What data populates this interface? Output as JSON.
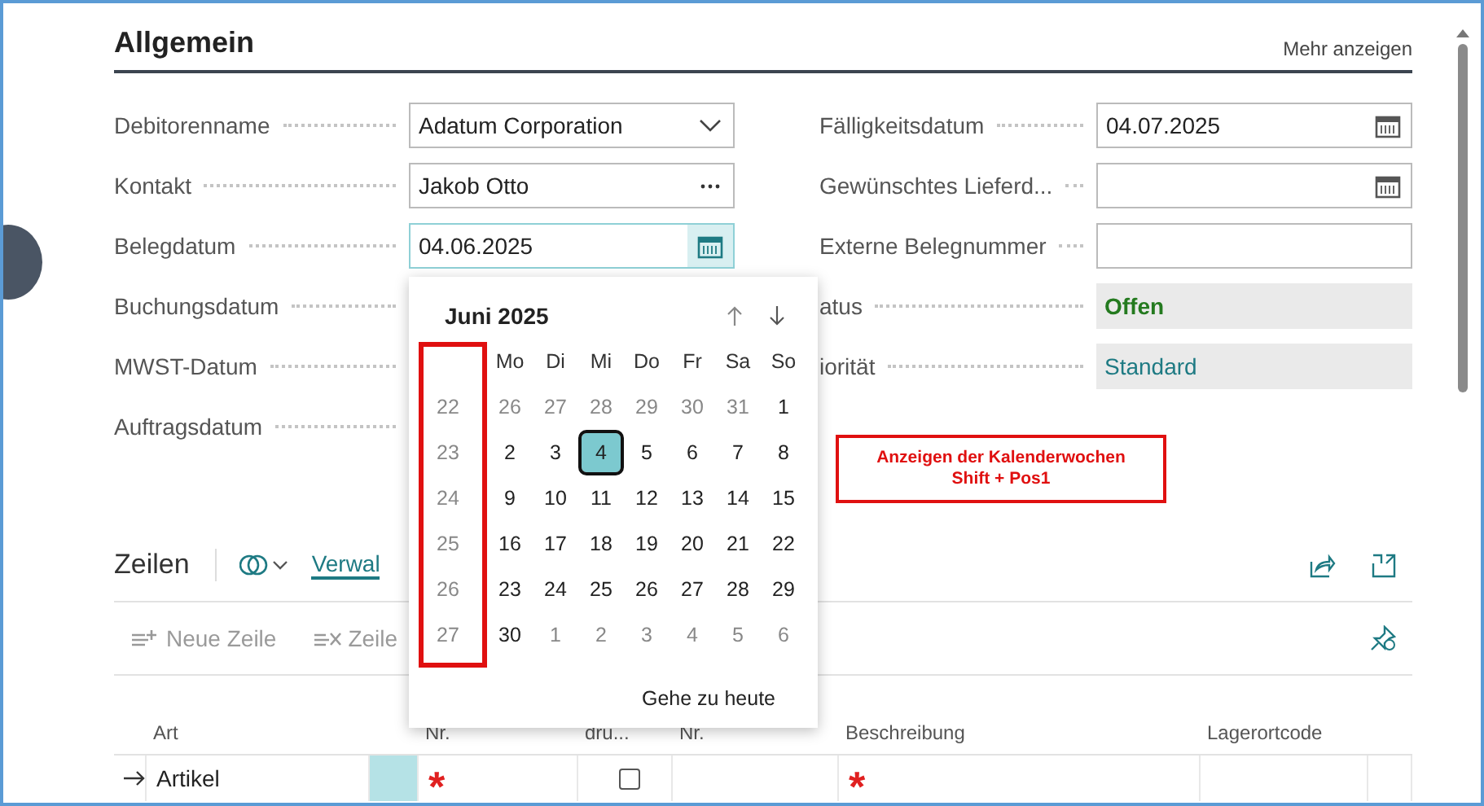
{
  "section": {
    "title": "Allgemein",
    "more_link": "Mehr anzeigen"
  },
  "fields_left": [
    {
      "label": "Debitorenname",
      "kind": "dropdown",
      "value": "Adatum Corporation"
    },
    {
      "label": "Kontakt",
      "kind": "lookup",
      "value": "Jakob Otto"
    },
    {
      "label": "Belegdatum",
      "kind": "date",
      "value": "04.06.2025",
      "focused": true
    },
    {
      "label": "Buchungsdatum",
      "kind": "covered"
    },
    {
      "label": "MWST-Datum",
      "kind": "covered"
    },
    {
      "label": "Auftragsdatum",
      "kind": "covered"
    }
  ],
  "fields_right": [
    {
      "label": "Fälligkeitsdatum",
      "kind": "date",
      "value": "04.07.2025",
      "focused": false
    },
    {
      "label": "Gewünschtes Lieferd...",
      "kind": "date",
      "focused": false
    },
    {
      "label": "Externe Belegnummer",
      "kind": "text"
    },
    {
      "label": "atus",
      "kind": "status",
      "value": "Offen"
    },
    {
      "label": "iorität",
      "kind": "readonly",
      "value": "Standard"
    }
  ],
  "calendar": {
    "month": "Juni 2025",
    "weekdays": [
      "Mo",
      "Di",
      "Mi",
      "Do",
      "Fr",
      "Sa",
      "So"
    ],
    "weeks": [
      {
        "number": "22",
        "days": [
          {
            "label": "26",
            "muted": true,
            "selected": false
          },
          {
            "label": "27",
            "muted": true,
            "selected": false
          },
          {
            "label": "28",
            "muted": true,
            "selected": false
          },
          {
            "label": "29",
            "muted": true,
            "selected": false
          },
          {
            "label": "30",
            "muted": true,
            "selected": false
          },
          {
            "label": "31",
            "muted": true,
            "selected": false
          },
          {
            "label": "1",
            "muted": false,
            "selected": false
          }
        ]
      },
      {
        "number": "23",
        "days": [
          {
            "label": "2",
            "muted": false,
            "selected": false
          },
          {
            "label": "3",
            "muted": false,
            "selected": false
          },
          {
            "label": "4",
            "muted": false,
            "selected": true
          },
          {
            "label": "5",
            "muted": false,
            "selected": false
          },
          {
            "label": "6",
            "muted": false,
            "selected": false
          },
          {
            "label": "7",
            "muted": false,
            "selected": false
          },
          {
            "label": "8",
            "muted": false,
            "selected": false
          }
        ]
      },
      {
        "number": "24",
        "days": [
          {
            "label": "9",
            "muted": false,
            "selected": false
          },
          {
            "label": "10",
            "muted": false,
            "selected": false
          },
          {
            "label": "11",
            "muted": false,
            "selected": false
          },
          {
            "label": "12",
            "muted": false,
            "selected": false
          },
          {
            "label": "13",
            "muted": false,
            "selected": false
          },
          {
            "label": "14",
            "muted": false,
            "selected": false
          },
          {
            "label": "15",
            "muted": false,
            "selected": false
          }
        ]
      },
      {
        "number": "25",
        "days": [
          {
            "label": "16",
            "muted": false,
            "selected": false
          },
          {
            "label": "17",
            "muted": false,
            "selected": false
          },
          {
            "label": "18",
            "muted": false,
            "selected": false
          },
          {
            "label": "19",
            "muted": false,
            "selected": false
          },
          {
            "label": "20",
            "muted": false,
            "selected": false
          },
          {
            "label": "21",
            "muted": false,
            "selected": false
          },
          {
            "label": "22",
            "muted": false,
            "selected": false
          }
        ]
      },
      {
        "number": "26",
        "days": [
          {
            "label": "23",
            "muted": false,
            "selected": false
          },
          {
            "label": "24",
            "muted": false,
            "selected": false
          },
          {
            "label": "25",
            "muted": false,
            "selected": false
          },
          {
            "label": "26",
            "muted": false,
            "selected": false
          },
          {
            "label": "27",
            "muted": false,
            "selected": false
          },
          {
            "label": "28",
            "muted": false,
            "selected": false
          },
          {
            "label": "29",
            "muted": false,
            "selected": false
          }
        ]
      },
      {
        "number": "27",
        "days": [
          {
            "label": "30",
            "muted": false,
            "selected": false
          },
          {
            "label": "1",
            "muted": true,
            "selected": false
          },
          {
            "label": "2",
            "muted": true,
            "selected": false
          },
          {
            "label": "3",
            "muted": true,
            "selected": false
          },
          {
            "label": "4",
            "muted": true,
            "selected": false
          },
          {
            "label": "5",
            "muted": true,
            "selected": false
          },
          {
            "label": "6",
            "muted": true,
            "selected": false
          }
        ]
      }
    ],
    "today_button": "Gehe zu heute"
  },
  "annotation": {
    "lines": [
      "Anzeigen der Kalenderwochen",
      "Shift + Pos1"
    ]
  },
  "lines": {
    "title": "Zeilen",
    "menu_tab": "Verwal",
    "actions": [
      {
        "label": "Neue Zeile",
        "kind": "new",
        "disabled": true
      },
      {
        "label": "Zeile",
        "kind": "delete",
        "disabled": true
      }
    ],
    "columns": [
      "Art",
      "Nr.",
      "dru...",
      "Nr.",
      "Beschreibung",
      "Lagerortcode"
    ],
    "rows": [
      {
        "type": "Artikel",
        "no": "*",
        "print_checked": false,
        "no2": "",
        "description": "*",
        "location": ""
      }
    ]
  }
}
